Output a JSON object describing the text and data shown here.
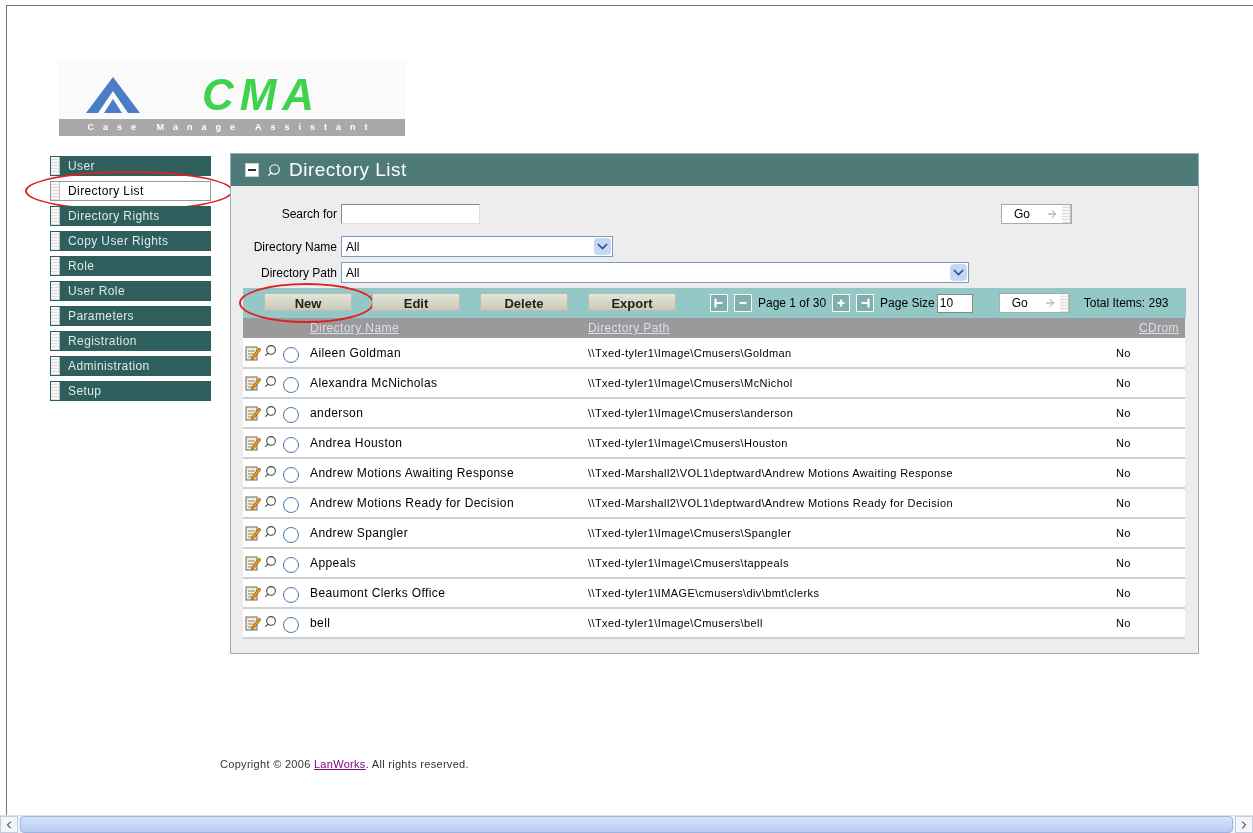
{
  "logo": {
    "title": "CMA",
    "subtitle": "Case Manage Assistant"
  },
  "sidebar": {
    "items": [
      {
        "label": "User",
        "selected": false,
        "circled": false
      },
      {
        "label": "Directory List",
        "selected": true,
        "circled": true
      },
      {
        "label": "Directory Rights",
        "selected": false,
        "circled": false
      },
      {
        "label": "Copy User Rights",
        "selected": false,
        "circled": false
      },
      {
        "label": "Role",
        "selected": false,
        "circled": false
      },
      {
        "label": "User Role",
        "selected": false,
        "circled": false
      },
      {
        "label": "Parameters",
        "selected": false,
        "circled": false
      },
      {
        "label": "Registration",
        "selected": false,
        "circled": false
      },
      {
        "label": "Administration",
        "selected": false,
        "circled": false
      },
      {
        "label": "Setup",
        "selected": false,
        "circled": false
      }
    ]
  },
  "panel": {
    "title": "Directory List",
    "search": {
      "label": "Search for",
      "go": "Go"
    },
    "filters": [
      {
        "label": "Directory Name",
        "value": "All"
      },
      {
        "label": "Directory Path",
        "value": "All"
      }
    ],
    "toolbar": {
      "buttons": [
        {
          "label": "New",
          "circled": true
        },
        {
          "label": "Edit",
          "circled": false
        },
        {
          "label": "Delete",
          "circled": false
        },
        {
          "label": "Export",
          "circled": false
        }
      ],
      "page_text": "Page 1 of 30",
      "page_size_label": "Page Size",
      "page_size": "10",
      "go": "Go",
      "total": "Total Items: 293"
    },
    "table": {
      "columns": [
        "Directory Name",
        "Directory Path",
        "CDrom"
      ],
      "rows": [
        {
          "name": "Aileen Goldman",
          "path": "\\\\Txed-tyler1\\Image\\Cmusers\\Goldman",
          "cdrom": "No",
          "selected": false
        },
        {
          "name": "Alexandra McNicholas",
          "path": "\\\\Txed-tyler1\\Image\\Cmusers\\McNichol",
          "cdrom": "No",
          "selected": false
        },
        {
          "name": "anderson",
          "path": "\\\\Txed-tyler1\\Image\\Cmusers\\anderson",
          "cdrom": "No",
          "selected": false
        },
        {
          "name": "Andrea Houston",
          "path": "\\\\Txed-tyler1\\Image\\Cmusers\\Houston",
          "cdrom": "No",
          "selected": false
        },
        {
          "name": "Andrew Motions Awaiting Response",
          "path": "\\\\Txed-Marshall2\\VOL1\\deptward\\Andrew Motions Awaiting Response",
          "cdrom": "No",
          "selected": false
        },
        {
          "name": "Andrew Motions Ready for Decision",
          "path": "\\\\Txed-Marshall2\\VOL1\\deptward\\Andrew Motions Ready for Decision",
          "cdrom": "No",
          "selected": false
        },
        {
          "name": "Andrew Spangler",
          "path": "\\\\Txed-tyler1\\Image\\Cmusers\\Spangler",
          "cdrom": "No",
          "selected": false
        },
        {
          "name": "Appeals",
          "path": "\\\\Txed-tyler1\\Image\\Cmusers\\tappeals",
          "cdrom": "No",
          "selected": false
        },
        {
          "name": "Beaumont Clerks Office",
          "path": "\\\\Txed-tyler1\\IMAGE\\cmusers\\div\\bmt\\clerks",
          "cdrom": "No",
          "selected": false
        },
        {
          "name": "bell",
          "path": "\\\\Txed-tyler1\\Image\\Cmusers\\bell",
          "cdrom": "No",
          "selected": false
        }
      ]
    }
  },
  "footer": {
    "prefix": "Copyright © 2006",
    "link": "LanWorks",
    "suffix": ". All rights reserved."
  }
}
